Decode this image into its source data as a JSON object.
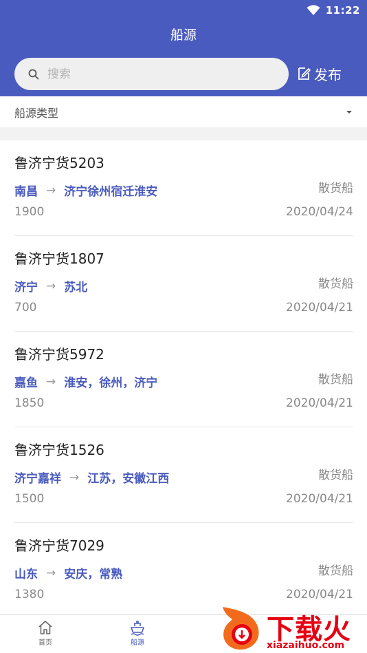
{
  "status_bar": {
    "time": "11:22",
    "wifi_icon": "wifi-icon",
    "battery_icon": "battery-icon"
  },
  "header": {
    "title": "船源",
    "search_placeholder": "搜索",
    "publish_label": "发布",
    "publish_icon": "edit-icon"
  },
  "filter": {
    "label": "船源类型",
    "caret_icon": "caret-down-icon"
  },
  "colors": {
    "primary": "#4a5bbf",
    "route": "#4a5bbf",
    "muted": "#8a8a8a",
    "watermark": "#e60012"
  },
  "items": [
    {
      "name": "鲁济宁货5203",
      "from": "南昌",
      "to": "济宁徐州宿迁淮安",
      "type": "散货船",
      "weight": "1900",
      "date": "2020/04/24"
    },
    {
      "name": "鲁济宁货1807",
      "from": "济宁",
      "to": "苏北",
      "type": "散货船",
      "weight": "700",
      "date": "2020/04/21"
    },
    {
      "name": "鲁济宁货5972",
      "from": "嘉鱼",
      "to": "淮安，徐州，济宁",
      "type": "散货船",
      "weight": "1850",
      "date": "2020/04/21"
    },
    {
      "name": "鲁济宁货1526",
      "from": "济宁嘉祥",
      "to": "江苏，安徽江西",
      "type": "散货船",
      "weight": "1500",
      "date": "2020/04/21"
    },
    {
      "name": "鲁济宁货7029",
      "from": "山东",
      "to": "安庆，常熟",
      "type": "散货船",
      "weight": "1380",
      "date": "2020/04/21"
    }
  ],
  "arrow": "→",
  "tabbar": {
    "home_label": "首页",
    "ship_label": "船源"
  },
  "watermark": {
    "text": "下载火",
    "url": "xiazaihuo.com"
  }
}
